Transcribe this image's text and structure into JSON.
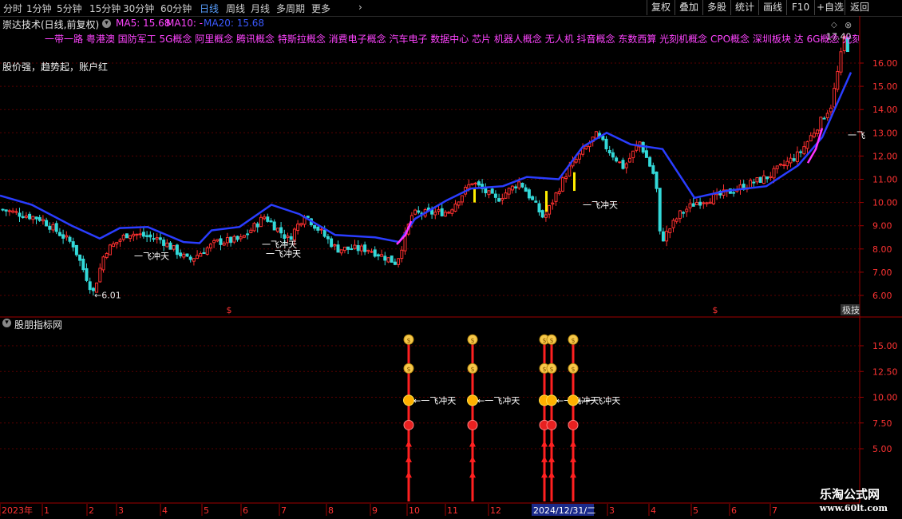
{
  "toolbar": {
    "timeframes": [
      "分时",
      "1分钟",
      "5分钟",
      "15分钟",
      "30分钟",
      "60分钟",
      "日线",
      "周线",
      "月线",
      "多周期",
      "更多"
    ],
    "active_timeframe": "日线",
    "more_icon": "chevron-right-icon",
    "right_buttons": [
      "复权",
      "叠加",
      "多股",
      "统计",
      "画线",
      "F10",
      "+自选",
      "返回"
    ]
  },
  "main_chart": {
    "stock_title": "崇达技术(日线,前复权)",
    "settings_icon": "chevron-down-circle-icon",
    "ma5_label": "MA5: 15.68",
    "ma10_label": "MA10: -",
    "ma20_label": "MA20: 15.68",
    "concepts_text": "一带一路 粤港澳 国防军工 5G概念 阿里概念 腾讯概念 特斯拉概念 消费电子概念 汽车电子 数据中心 芯片 机器人概念 无人机 抖音概念 东数西算 光刻机概念 CPO概念 深圳板块 达 6G概念 光刻机器人",
    "slogan": "股价强，趋势起，账户红",
    "price_ticks": [
      "16.00",
      "15.00",
      "14.00",
      "13.00",
      "12.00",
      "11.00",
      "10.00",
      "9.00",
      "8.00",
      "7.00",
      "6.00"
    ],
    "low_marker": "←6.01",
    "high_marker": "17.40",
    "signal_label": "一飞冲天",
    "end_signal_label": "一飞",
    "dollar_symbol": "$",
    "corner_tag": "极技",
    "colors": {
      "up": "#ff3030",
      "down": "#33d9d9",
      "ma20": "#2a3dff",
      "ma_pink": "#ff33ff",
      "concepts": "#ff44ff",
      "label_yellow": "#ffffff"
    }
  },
  "chart_data": [
    {
      "type": "candlestick",
      "title": "崇达技术(日线,前复权)",
      "ylim": [
        5.7,
        17.4
      ],
      "y_ticks": [
        6,
        7,
        8,
        9,
        10,
        11,
        12,
        13,
        14,
        15,
        16
      ],
      "x_ticks": [
        "2023年",
        "1",
        "2",
        "3",
        "4",
        "5",
        "6",
        "7",
        "8",
        "9",
        "10",
        "11",
        "12",
        "2024/12/31/二",
        "3",
        "4",
        "5",
        "6",
        "7"
      ],
      "series": [
        {
          "name": "MA20",
          "points": [
            [
              0,
              10.3
            ],
            [
              40,
              9.9
            ],
            [
              90,
              9.0
            ],
            [
              125,
              8.45
            ],
            [
              150,
              8.9
            ],
            [
              185,
              8.95
            ],
            [
              230,
              8.3
            ],
            [
              250,
              8.25
            ],
            [
              265,
              8.8
            ],
            [
              300,
              8.95
            ],
            [
              340,
              9.9
            ],
            [
              375,
              9.5
            ],
            [
              420,
              8.6
            ],
            [
              470,
              8.5
            ],
            [
              500,
              8.3
            ],
            [
              520,
              9.3
            ],
            [
              560,
              10.1
            ],
            [
              590,
              10.6
            ],
            [
              630,
              10.7
            ],
            [
              660,
              11.1
            ],
            [
              700,
              11.0
            ],
            [
              730,
              12.4
            ],
            [
              760,
              13.0
            ],
            [
              790,
              12.5
            ],
            [
              830,
              12.3
            ],
            [
              870,
              10.2
            ],
            [
              910,
              10.5
            ],
            [
              960,
              10.7
            ],
            [
              1000,
              11.6
            ],
            [
              1030,
              12.8
            ],
            [
              1066,
              15.6
            ]
          ]
        },
        {
          "name": "Price (approx. close)",
          "points": [
            [
              0,
              9.7
            ],
            [
              50,
              9.3
            ],
            [
              90,
              8.2
            ],
            [
              115,
              6.1
            ],
            [
              130,
              7.9
            ],
            [
              160,
              8.7
            ],
            [
              200,
              8.4
            ],
            [
              235,
              7.5
            ],
            [
              270,
              8.3
            ],
            [
              300,
              8.4
            ],
            [
              330,
              9.4
            ],
            [
              360,
              8.4
            ],
            [
              380,
              9.5
            ],
            [
              420,
              8.0
            ],
            [
              460,
              8.0
            ],
            [
              495,
              7.4
            ],
            [
              515,
              9.5
            ],
            [
              560,
              9.6
            ],
            [
              590,
              10.9
            ],
            [
              620,
              10.1
            ],
            [
              650,
              10.9
            ],
            [
              680,
              9.3
            ],
            [
              710,
              11.4
            ],
            [
              745,
              12.9
            ],
            [
              780,
              11.5
            ],
            [
              800,
              12.6
            ],
            [
              820,
              11.0
            ],
            [
              826,
              8.3
            ],
            [
              850,
              9.5
            ],
            [
              870,
              10.0
            ],
            [
              900,
              10.3
            ],
            [
              960,
              11.1
            ],
            [
              1000,
              12.1
            ],
            [
              1040,
              14.2
            ],
            [
              1058,
              17.4
            ],
            [
              1065,
              15.2
            ]
          ]
        }
      ],
      "signals": [
        {
          "label": "一飞冲天",
          "x": 168,
          "price": 7.7
        },
        {
          "label": "一飞冲天",
          "x": 328,
          "price": 8.2
        },
        {
          "label": "一飞冲天",
          "x": 333,
          "price": 7.8
        },
        {
          "label": "一飞冲天",
          "x": 730,
          "price": 9.9
        },
        {
          "label": "一飞",
          "x": 1062,
          "price": 12.9
        }
      ],
      "annotations": [
        {
          "text": "←6.01",
          "x": 118,
          "price": 6.01
        },
        {
          "text": "17.40",
          "x": 1035,
          "price": 17.1
        }
      ]
    },
    {
      "type": "indicator",
      "title": "股朋指标网",
      "ylim": [
        2,
        17.5
      ],
      "y_ticks": [
        5.0,
        7.5,
        10.0,
        12.5,
        15.0
      ],
      "y_tick_labels": [
        "5.00",
        "7.50",
        "10.00",
        "12.50",
        "15.00"
      ],
      "columns": [
        {
          "x": 512,
          "label": "一飞冲天"
        },
        {
          "x": 592,
          "label": "一飞冲天"
        },
        {
          "x": 682,
          "label": ""
        },
        {
          "x": 691,
          "label": "一飞冲天"
        },
        {
          "x": 718,
          "label": "一飞冲天"
        }
      ],
      "icon_levels": {
        "top_coin": 15.6,
        "mid_coin": 12.8,
        "sun": 9.7,
        "badge": 7.3
      },
      "arrow_levels": [
        5.5,
        4.0,
        2.5
      ]
    }
  ],
  "indicator_panel": {
    "title": "股朋指标网",
    "toggle_icon": "chevron-down-circle-icon"
  },
  "x_axis": {
    "labels": [
      "2023年",
      "1",
      "2",
      "3",
      "4",
      "5",
      "6",
      "7",
      "8",
      "9",
      "10",
      "11",
      "12",
      "2024/12/31/二",
      "3",
      "4",
      "5",
      "6",
      "7"
    ],
    "highlight": "2024/12/31/二"
  },
  "watermark": {
    "line1": "乐淘公式网",
    "line2": "www.60lt.com"
  }
}
